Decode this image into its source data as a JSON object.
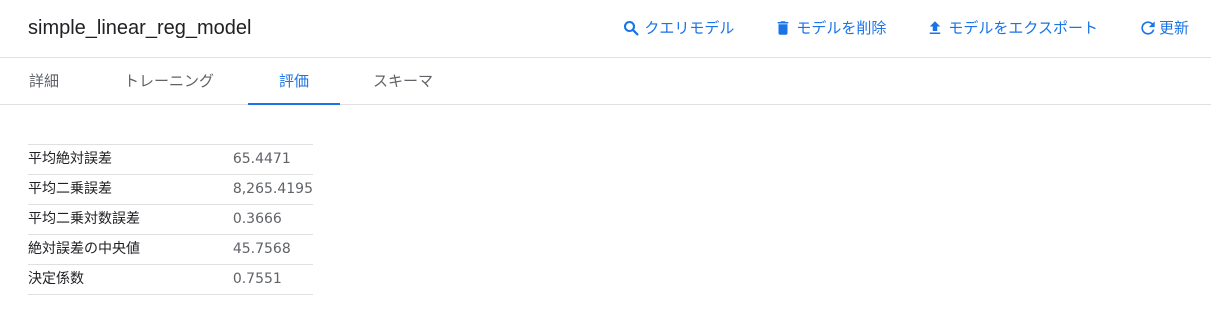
{
  "header": {
    "title": "simple_linear_reg_model",
    "actions": [
      {
        "label": "クエリモデル",
        "icon": "search-icon"
      },
      {
        "label": "モデルを削除",
        "icon": "trash-icon"
      },
      {
        "label": "モデルをエクスポート",
        "icon": "upload-icon"
      },
      {
        "label": "更新",
        "icon": "refresh-icon"
      }
    ]
  },
  "tabs": [
    {
      "label": "詳細",
      "active": false
    },
    {
      "label": "トレーニング",
      "active": false
    },
    {
      "label": "評価",
      "active": true
    },
    {
      "label": "スキーマ",
      "active": false
    }
  ],
  "metrics": [
    {
      "label": "平均絶対誤差",
      "value": "65.4471"
    },
    {
      "label": "平均二乗誤差",
      "value": "8,265.4195"
    },
    {
      "label": "平均二乗対数誤差",
      "value": "0.3666"
    },
    {
      "label": "絶対誤差の中央値",
      "value": "45.7568"
    },
    {
      "label": "決定係数",
      "value": "0.7551"
    }
  ],
  "colors": {
    "accent": "#1a73e8",
    "text": "#202124",
    "muted": "#5f6368",
    "divider": "#e0e0e0"
  }
}
